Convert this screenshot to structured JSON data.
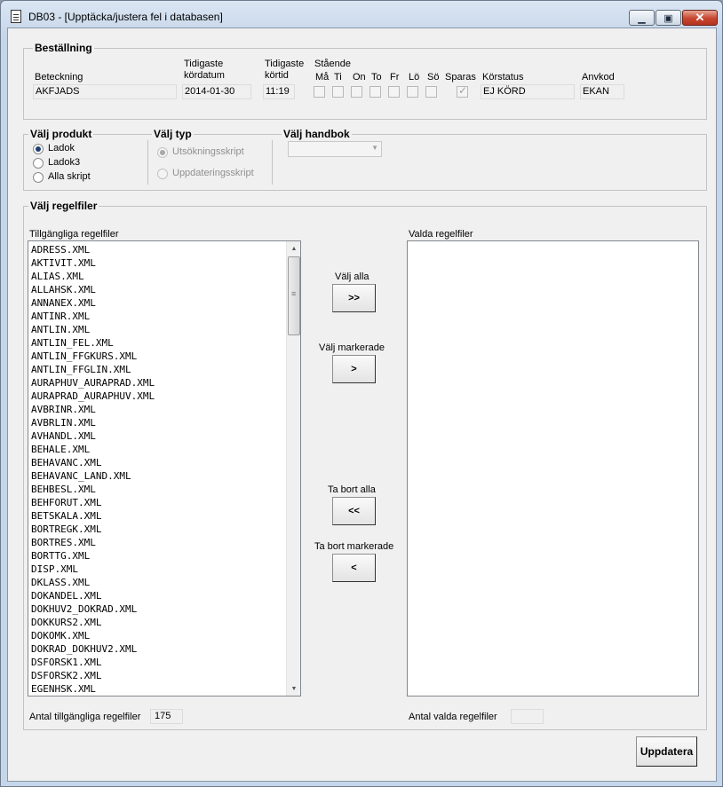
{
  "window": {
    "title": "DB03 - [Upptäcka/justera fel i databasen]",
    "minimize": "▁",
    "maximize": "▣",
    "close": "✕"
  },
  "order": {
    "title": "Beställning",
    "beteckning_label": "Beteckning",
    "beteckning_value": "AKFJADS",
    "kordatum_label_1": "Tidigaste",
    "kordatum_label_2": "kördatum",
    "kordatum_value": "2014-01-30",
    "kortid_label_1": "Tidigaste",
    "kortid_label_2": "körtid",
    "kortid_value": "11:19",
    "standing_label": "Stående",
    "days": [
      "Må",
      "Ti",
      "On",
      "To",
      "Fr",
      "Lö",
      "Sö"
    ],
    "sparas_label": "Sparas",
    "korstatus_label": "Körstatus",
    "korstatus_value": "EJ KÖRD",
    "anvkod_label": "Anvkod",
    "anvkod_value": "EKAN"
  },
  "product": {
    "title": "Välj produkt",
    "options": [
      "Ladok",
      "Ladok3",
      "Alla skript"
    ],
    "selected": "Ladok"
  },
  "type": {
    "title": "Välj typ",
    "options": [
      "Utsökningsskript",
      "Uppdateringsskript"
    ],
    "selected": "Utsökningsskript"
  },
  "handbook": {
    "title": "Välj handbok",
    "value": ""
  },
  "rules": {
    "title": "Välj regelfiler",
    "available_label": "Tillgängliga regelfiler",
    "selected_label": "Valda regelfiler",
    "available_files": [
      "ADRESS.XML",
      "AKTIVIT.XML",
      "ALIAS.XML",
      "ALLAHSK.XML",
      "ANNANEX.XML",
      "ANTINR.XML",
      "ANTLIN.XML",
      "ANTLIN_FEL.XML",
      "ANTLIN_FFGKURS.XML",
      "ANTLIN_FFGLIN.XML",
      "AURAPHUV_AURAPRAD.XML",
      "AURAPRAD_AURAPHUV.XML",
      "AVBRINR.XML",
      "AVBRLIN.XML",
      "AVHANDL.XML",
      "BEHALE.XML",
      "BEHAVANC.XML",
      "BEHAVANC_LAND.XML",
      "BEHBESL.XML",
      "BEHFORUT.XML",
      "BETSKALA.XML",
      "BORTREGK.XML",
      "BORTRES.XML",
      "BORTTG.XML",
      "DISP.XML",
      "DKLASS.XML",
      "DOKANDEL.XML",
      "DOKHUV2_DOKRAD.XML",
      "DOKKURS2.XML",
      "DOKOMK.XML",
      "DOKRAD_DOKHUV2.XML",
      "DSFORSK1.XML",
      "DSFORSK2.XML",
      "EGENHSK.XML"
    ],
    "selected_files": [],
    "select_all_label": "Välj alla",
    "select_all_btn": ">>",
    "select_marked_label": "Välj markerade",
    "select_marked_btn": ">",
    "remove_all_label": "Ta bort alla",
    "remove_all_btn": "<<",
    "remove_marked_label": "Ta bort markerade",
    "remove_marked_btn": "<",
    "available_count_label": "Antal tillgängliga regelfiler",
    "available_count": "175",
    "selected_count_label": "Antal valda regelfiler",
    "selected_count": ""
  },
  "update_button": "Uppdatera",
  "icons": {
    "app": "document-icon",
    "scroll_up": "▲",
    "scroll_down": "▼",
    "dropdown": "▼"
  }
}
